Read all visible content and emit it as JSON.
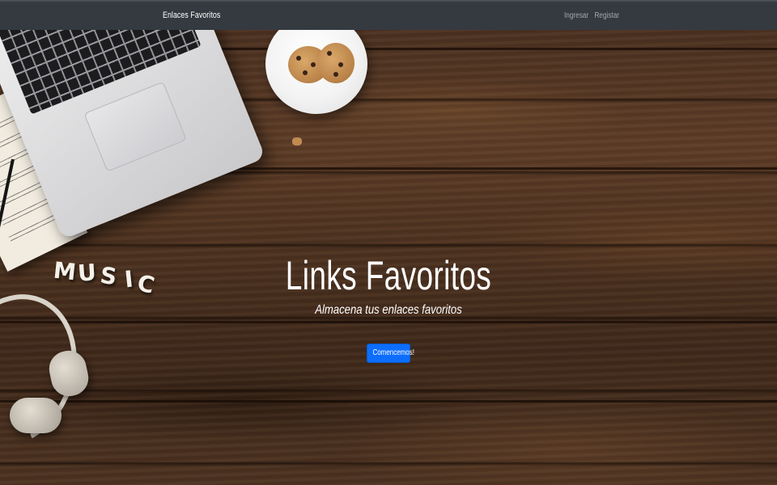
{
  "navbar": {
    "brand": "Enlaces Favoritos",
    "links": [
      {
        "label": "Ingresar"
      },
      {
        "label": "Registar"
      }
    ],
    "background": "#343a40"
  },
  "hero": {
    "title": "Links Favoritos",
    "subtitle": "Almacena tus enlaces favoritos",
    "cta_label": "Comencemos!",
    "cta_color": "#0d6efd",
    "background_image": "wooden desk with laptop, cookies, sheet music, headphones",
    "decor_text": [
      "M",
      "U",
      "S",
      "I",
      "C"
    ]
  }
}
